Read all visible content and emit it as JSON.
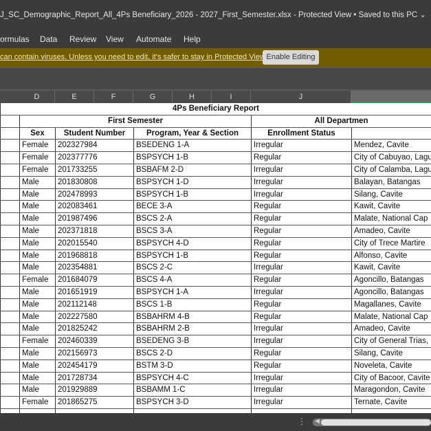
{
  "window": {
    "title": "J_SC_Demographic_Report_All_4Ps Beneficiary_2026 - 2027_First_Semester.xlsx  -  Protected View • Saved to this PC ⌄"
  },
  "menu": [
    "ormulas",
    "Data",
    "Review",
    "View",
    "Automate",
    "Help"
  ],
  "protected": {
    "message": "can contain viruses. Unless you need to edit, it's safer to stay in Protected View.",
    "button": "Enable Editing"
  },
  "columns": [
    "D",
    "E",
    "F",
    "G",
    "H",
    "I",
    "J",
    ""
  ],
  "sheet": {
    "title": "4Ps Beneficiary Report",
    "semester": "First Semester",
    "department": "All Departmen",
    "headers": [
      "Sex",
      "Student Number",
      "Program, Year & Section",
      "Enrollment Status",
      ""
    ],
    "rows": [
      [
        "Female",
        "202327984",
        "BSEDENG 1-A",
        "Irregular",
        "Mendez, Cavite"
      ],
      [
        "Female",
        "202377776",
        "BSPSYCH 1-B",
        "Regular",
        "City of Cabuyao, Lagu"
      ],
      [
        "Female",
        "201733255",
        "BSBAFM 2-D",
        "Irregular",
        "City of Calamba, Lagu"
      ],
      [
        "Male",
        "201830808",
        "BSPSYCH 1-D",
        "Irregular",
        "Balayan, Batangas"
      ],
      [
        "Male",
        "202478993",
        "BSPSYCH 1-B",
        "Irregular",
        "Silang, Cavite"
      ],
      [
        "Male",
        "202083461",
        "BECE 3-A",
        "Regular",
        "Kawit, Cavite"
      ],
      [
        "Male",
        "201987496",
        "BSCS 2-A",
        "Regular",
        "Malate, National Cap"
      ],
      [
        "Male",
        "202371818",
        "BSCS 3-A",
        "Regular",
        "Amadeo, Cavite"
      ],
      [
        "Male",
        "202015540",
        "BSPSYCH 4-D",
        "Regular",
        "City of Trece Martire"
      ],
      [
        "Male",
        "201968818",
        "BSPSYCH 1-B",
        "Regular",
        "Alfonso, Cavite"
      ],
      [
        "Male",
        "202354881",
        "BSCS 2-C",
        "Irregular",
        "Kawit, Cavite"
      ],
      [
        "Female",
        "201684079",
        "BSCS 4-A",
        "Regular",
        "Agoncillo, Batangas"
      ],
      [
        "Male",
        "201651919",
        "BSPSYCH 1-A",
        "Irregular",
        "Agoncillo, Batangas"
      ],
      [
        "Male",
        "202112148",
        "BSCS 1-B",
        "Regular",
        "Magallanes, Cavite"
      ],
      [
        "Male",
        "202227580",
        "BSBAHRM 4-B",
        "Regular",
        "Malate, National Cap"
      ],
      [
        "Male",
        "201825242",
        "BSBAHRM 2-B",
        "Irregular",
        "Amadeo, Cavite"
      ],
      [
        "Female",
        "202460339",
        "BSEDENG 3-B",
        "Irregular",
        "City of General Trias,"
      ],
      [
        "Male",
        "202156973",
        "BSCS 2-D",
        "Regular",
        "Silang, Cavite"
      ],
      [
        "Male",
        "202454179",
        "BSTM 3-D",
        "Regular",
        "Noveleta, Cavite"
      ],
      [
        "Male",
        "201728734",
        "BSPSYCH 4-C",
        "Irregular",
        "City of Bacoor, Cavite"
      ],
      [
        "Male",
        "201929889",
        "BSBAMM 1-C",
        "Irregular",
        "Maragondon, Cavite"
      ],
      [
        "Female",
        "201865275",
        "BSPSYCH 3-D",
        "Irregular",
        "Ternate, Cavite"
      ]
    ]
  }
}
